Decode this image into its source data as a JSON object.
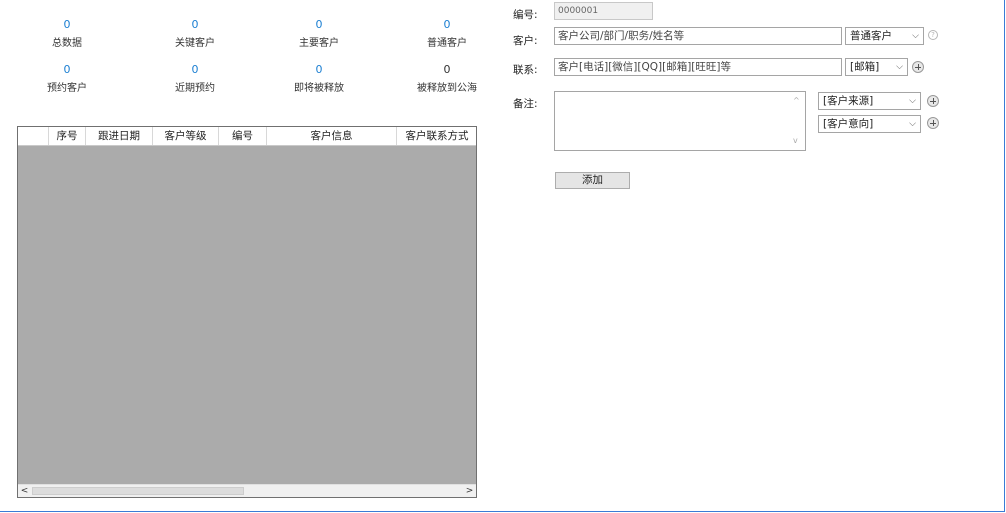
{
  "stats": [
    {
      "value": "0",
      "label": "总数据"
    },
    {
      "value": "0",
      "label": "关键客户"
    },
    {
      "value": "0",
      "label": "主要客户"
    },
    {
      "value": "0",
      "label": "普通客户"
    },
    {
      "value": "0",
      "label": "预约客户"
    },
    {
      "value": "0",
      "label": "近期预约"
    },
    {
      "value": "0",
      "label": "即将被释放"
    },
    {
      "value": "0",
      "label": "被释放到公海"
    }
  ],
  "table": {
    "columns": [
      "序号",
      "跟进日期",
      "客户等级",
      "编号",
      "客户信息",
      "客户联系方式"
    ]
  },
  "form": {
    "number_label": "编号:",
    "number_value": "0000001",
    "customer_label": "客户:",
    "customer_placeholder": "客户公司/部门/职务/姓名等",
    "customer_type": "普通客户",
    "contact_label": "联系:",
    "contact_placeholder": "客户[电话][微信][QQ][邮箱][旺旺]等",
    "contact_type": "[邮箱]",
    "note_label": "备注:",
    "source_select": "[客户来源]",
    "intent_select": "[客户意向]",
    "add_button": "添加"
  }
}
